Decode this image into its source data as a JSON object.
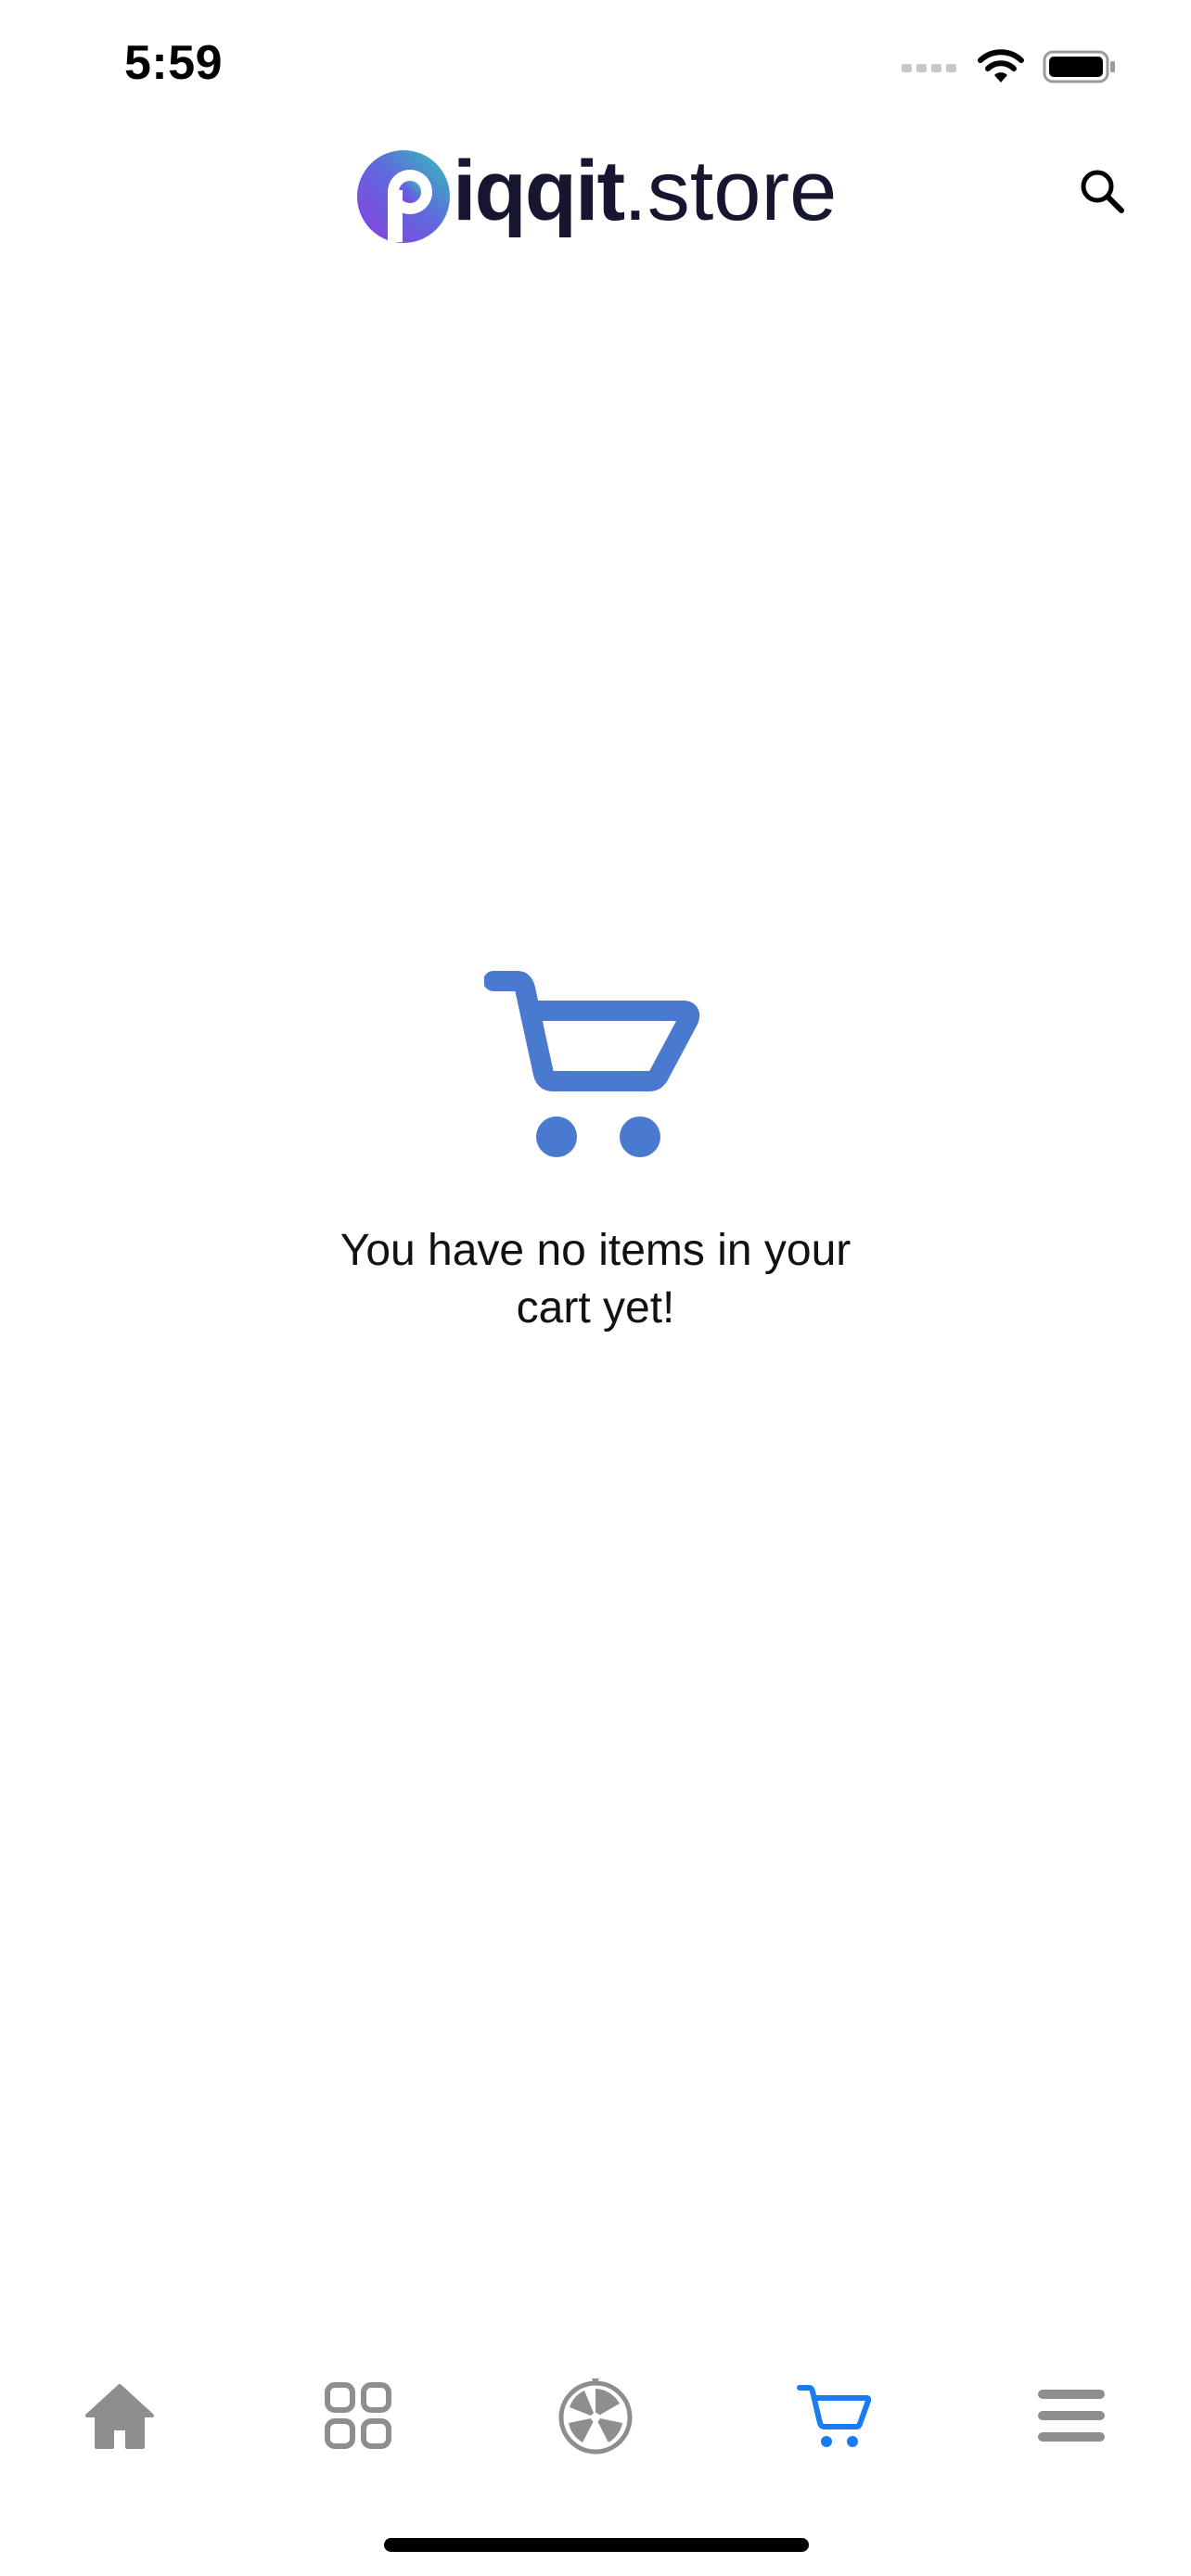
{
  "status_bar": {
    "time": "5:59",
    "icons": [
      "cellular-signal-icon",
      "wifi-icon",
      "battery-icon"
    ]
  },
  "header": {
    "logo_bold": "iqqit",
    "logo_light": ".store",
    "logo_mark_letter": "p",
    "search_icon": "search-icon"
  },
  "empty_cart": {
    "icon": "shopping-cart-icon",
    "message": "You have no items in your cart yet!",
    "icon_color": "#4A7ACF"
  },
  "tab_bar": {
    "tabs": [
      {
        "name": "home",
        "icon": "home-icon",
        "active": false
      },
      {
        "name": "categories",
        "icon": "grid-icon",
        "active": false
      },
      {
        "name": "wheel",
        "icon": "wheel-icon",
        "active": false
      },
      {
        "name": "cart",
        "icon": "cart-icon",
        "active": true
      },
      {
        "name": "menu",
        "icon": "menu-icon",
        "active": false
      }
    ],
    "active_color": "#1A7CF0",
    "inactive_color": "#8E8E8E"
  }
}
